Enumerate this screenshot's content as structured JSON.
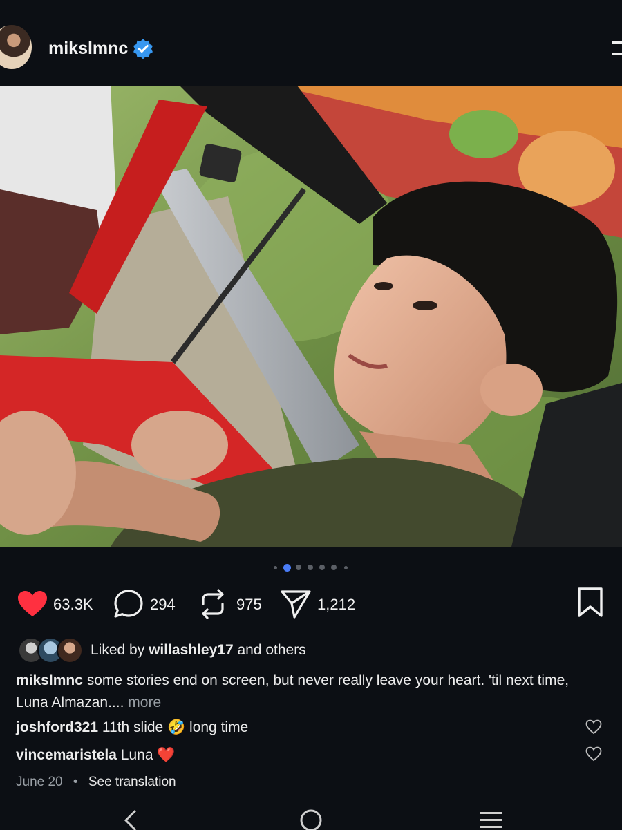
{
  "header": {
    "username": "mikslmnc",
    "verified": true
  },
  "carousel": {
    "total": 7,
    "active_index": 1
  },
  "actions": {
    "likes": "63.3K",
    "comments": "294",
    "reposts": "975",
    "shares": "1,212",
    "liked": true
  },
  "liked_by": {
    "prefix": "Liked by",
    "user": "willashley17",
    "suffix": "and others"
  },
  "caption": {
    "username": "mikslmnc",
    "text": "some stories end on screen, but never really leave your heart. 'til next time, Luna Almazan....",
    "more": "more"
  },
  "comments": [
    {
      "username": "joshford321",
      "text": "11th slide 🤣 long time"
    },
    {
      "username": "vincemaristela",
      "text": "Luna ❤️"
    }
  ],
  "meta": {
    "date": "June 20",
    "separator": "•",
    "translate": "See translation"
  },
  "colors": {
    "background": "#0c0f14",
    "like_red": "#ff3040",
    "verified_blue": "#3797f0",
    "active_dot": "#4a7cf7"
  },
  "icons": [
    "heart-icon",
    "comment-icon",
    "repost-icon",
    "share-icon",
    "bookmark-icon",
    "verified-icon",
    "menu-icon",
    "back-icon",
    "home-icon",
    "recents-icon"
  ]
}
